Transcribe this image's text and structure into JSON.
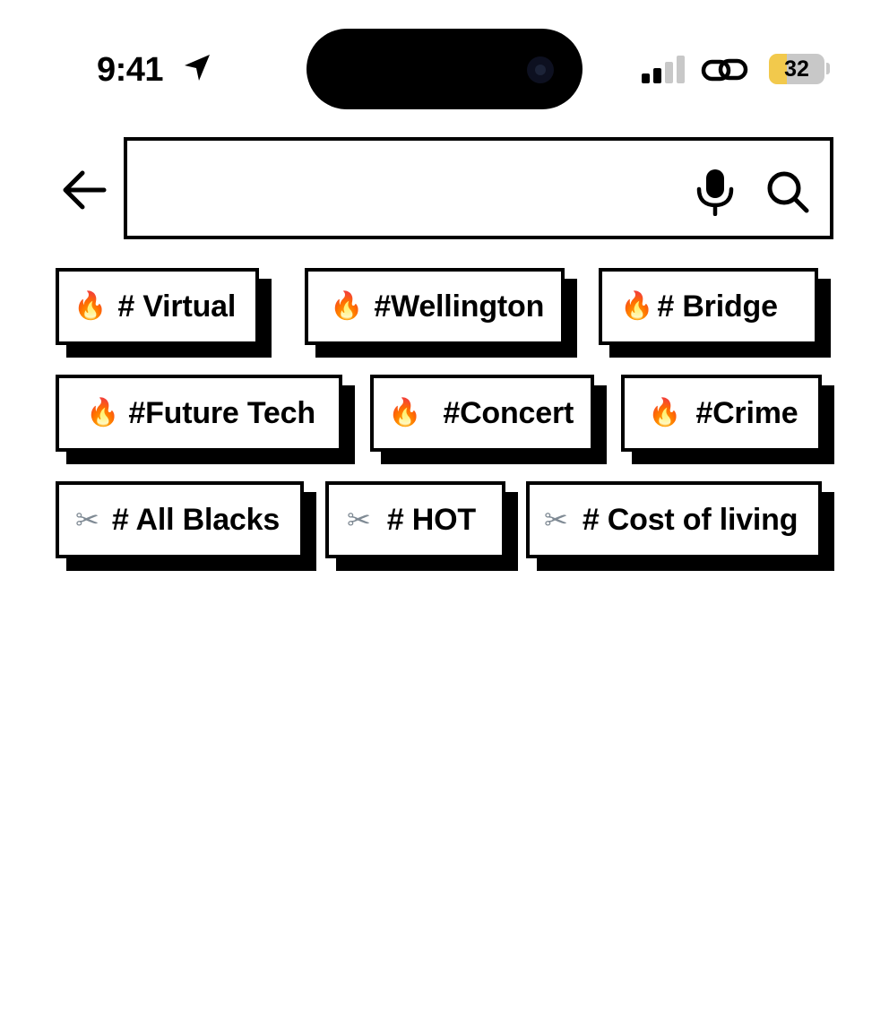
{
  "status_bar": {
    "time": "9:41",
    "battery_level": "32",
    "icons": [
      "location-arrow-icon",
      "signal-icon",
      "link-icon",
      "battery-icon"
    ]
  },
  "search": {
    "value": "",
    "placeholder": "",
    "icons": [
      "back-arrow-icon",
      "microphone-icon",
      "search-icon"
    ]
  },
  "tags": [
    {
      "icon": "🔥",
      "label": "# Virtual"
    },
    {
      "icon": "🔥",
      "label": "#Wellington"
    },
    {
      "icon": "🔥",
      "label": "# Bridge"
    },
    {
      "icon": "🔥",
      "label": "#Future Tech"
    },
    {
      "icon": "🔥",
      "label": "#Concert"
    },
    {
      "icon": "🔥",
      "label": "#Crime"
    },
    {
      "icon": "✂",
      "label": "# All Blacks"
    },
    {
      "icon": "✂",
      "label": "# HOT"
    },
    {
      "icon": "✂",
      "label": "# Cost of living"
    }
  ],
  "colors": {
    "battery_fill": "#f2c94c",
    "fire": "#f26a1b",
    "border": "#000000"
  }
}
